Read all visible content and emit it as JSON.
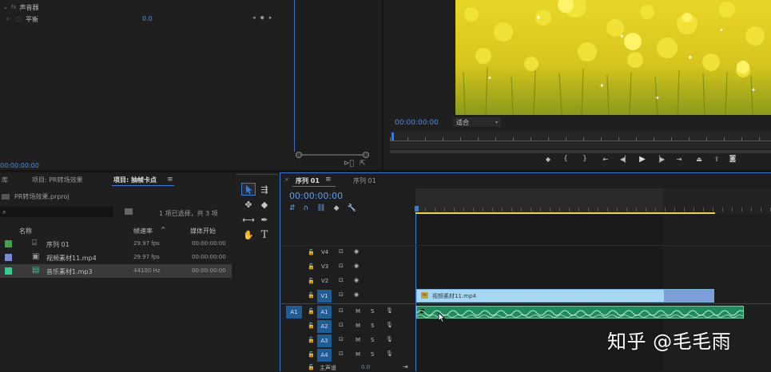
{
  "effect_controls": {
    "row1_label": "声音器",
    "row2_label": "平衡",
    "row2_value": "0.0",
    "timecode": "00:00:00:00"
  },
  "program_monitor": {
    "timecode": "00:00:00:00",
    "fit_label": "适合"
  },
  "project_panel": {
    "lib_tab": "库",
    "tab1": "项目: PR转场效果",
    "tab2": "项目: 抽帧卡点",
    "project_file": "PR转场效果.prproj",
    "selection_info": "1 项已选择，共 3 项",
    "col_name": "名称",
    "col_fps": "帧速率",
    "col_start": "媒体开始",
    "items": [
      {
        "name": "序列 01",
        "fps": "29.97 fps",
        "start": "00:00:00:00",
        "color": "#3fa34d"
      },
      {
        "name": "视频素材11.mp4",
        "fps": "29.97 fps",
        "start": "00:00:00:00",
        "color": "#7b8ad1"
      },
      {
        "name": "音乐素材1.mp3",
        "fps": "44100 Hz",
        "start": "00:00:00:00",
        "color": "#2fcf8f"
      }
    ]
  },
  "timeline": {
    "tab_active": "序列 01",
    "tab_other": "序列 01",
    "timecode": "00:00:00:00",
    "video_tracks": [
      "V4",
      "V3",
      "V2",
      "V1"
    ],
    "audio_tracks": [
      "A1",
      "A2",
      "A3",
      "A4"
    ],
    "source_patch_v": "V1",
    "source_patch_a": "A1",
    "mute_label": "M",
    "solo_label": "S",
    "video_clip_label": "视频素材11.mp4",
    "master_label": "主声道",
    "master_value": "0.0"
  },
  "watermark": "知乎 @毛毛雨",
  "colors": {
    "accent_blue": "#3b7bd8",
    "video_clip": "#a5d6f2",
    "audio_clip": "#1f8a5c",
    "work_area": "#e7d93a"
  }
}
